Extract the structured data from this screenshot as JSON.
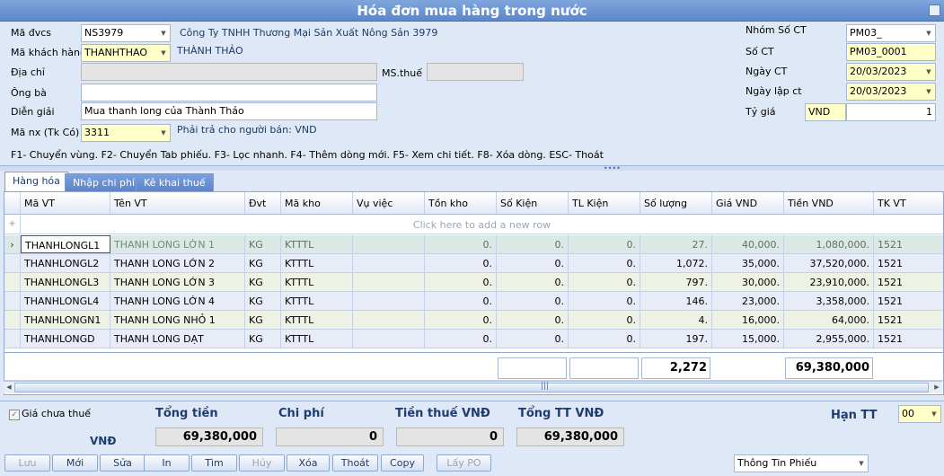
{
  "window": {
    "title": "Hóa đơn mua hàng trong nước"
  },
  "header": {
    "ma_dvcs": {
      "label": "Mã đvcs",
      "value": "NS3979",
      "desc": "Công Ty TNHH Thương Mại Sản Xuất Nông Sản 3979"
    },
    "ma_kh": {
      "label": "Mã khách hàng",
      "value": "THANHTHAO",
      "desc": "THÀNH THẢO"
    },
    "dia_chi": {
      "label": "Địa chỉ",
      "value": ""
    },
    "ms_thue": {
      "label": "MS.thuế",
      "value": ""
    },
    "ong_ba": {
      "label": "Ông bà",
      "value": ""
    },
    "dien_giai": {
      "label": "Diễn giải",
      "value": "Mua thanh long của Thành Thảo"
    },
    "ma_nx": {
      "label": "Mã nx (Tk Có)",
      "value": "3311",
      "desc": "Phải trả cho người bán: VND"
    },
    "nhom_so_ct": {
      "label": "Nhóm Số CT",
      "value": "PM03_"
    },
    "so_ct": {
      "label": "Số CT",
      "value": "PM03_0001"
    },
    "ngay_ct": {
      "label": "Ngày CT",
      "value": "20/03/2023"
    },
    "ngay_lap_ct": {
      "label": "Ngày lập ct",
      "value": "20/03/2023"
    },
    "ty_gia": {
      "label": "Tỷ giá",
      "currency": "VND",
      "value": "1"
    },
    "hotkeys": "F1- Chuyển vùng. F2- Chuyển Tab phiếu. F3- Lọc nhanh. F4- Thêm dòng mới. F5- Xem chi tiết. F8- Xóa dòng. ESC- Thoát"
  },
  "tabs": [
    {
      "label": "Hàng hóa"
    },
    {
      "label": "Nhập chi phí"
    },
    {
      "label": "Kê khai thuế"
    }
  ],
  "grid": {
    "columns": [
      "Mã VT",
      "Tên VT",
      "Đvt",
      "Mã kho",
      "Vụ việc",
      "Tồn kho",
      "Số Kiện",
      "TL Kiện",
      "Số lượng",
      "Giá VND",
      "Tiền VND",
      "TK VT"
    ],
    "new_row_text": "Click here to add a new row",
    "rows": [
      [
        "THANHLONGL1",
        "THANH LONG LỚN 1",
        "KG",
        "KTTTL",
        "",
        "0.",
        "0.",
        "0.",
        "27.",
        "40,000.",
        "1,080,000.",
        "1521"
      ],
      [
        "THANHLONGL2",
        "THANH LONG LỚN 2",
        "KG",
        "KTTTL",
        "",
        "0.",
        "0.",
        "0.",
        "1,072.",
        "35,000.",
        "37,520,000.",
        "1521"
      ],
      [
        "THANHLONGL3",
        "THANH LONG LỚN 3",
        "KG",
        "KTTTL",
        "",
        "0.",
        "0.",
        "0.",
        "797.",
        "30,000.",
        "23,910,000.",
        "1521"
      ],
      [
        "THANHLONGL4",
        "THANH LONG LỚN 4",
        "KG",
        "KTTTL",
        "",
        "0.",
        "0.",
        "0.",
        "146.",
        "23,000.",
        "3,358,000.",
        "1521"
      ],
      [
        "THANHLONGN1",
        "THANH LONG NHỎ 1",
        "KG",
        "KTTTL",
        "",
        "0.",
        "0.",
        "0.",
        "4.",
        "16,000.",
        "64,000.",
        "1521"
      ],
      [
        "THANHLONGD",
        "THANH LONG DẠT",
        "KG",
        "KTTTL",
        "",
        "0.",
        "0.",
        "0.",
        "197.",
        "15,000.",
        "2,955,000.",
        "1521"
      ]
    ],
    "totals": {
      "so_luong": "2,272",
      "tien_vnd": "69,380,000"
    }
  },
  "footer": {
    "gia_chua_thue": "Giá chưa thuế",
    "currency": "VNĐ",
    "tong_tien": {
      "label": "Tổng tiền",
      "value": "69,380,000"
    },
    "chi_phi": {
      "label": "Chi phí",
      "value": "0"
    },
    "tien_thue": {
      "label": "Tiền thuế VNĐ",
      "value": "0"
    },
    "tong_tt": {
      "label": "Tổng TT VNĐ",
      "value": "69,380,000"
    },
    "han_tt": {
      "label": "Hạn TT",
      "value": "00"
    },
    "thong_tin": "Thông Tin Phiếu"
  },
  "buttons": [
    "Lưu",
    "Mới",
    "Sửa",
    "In",
    "Tìm",
    "Hủy",
    "Xóa",
    "Thoát",
    "Copy",
    "Lấy PO"
  ]
}
